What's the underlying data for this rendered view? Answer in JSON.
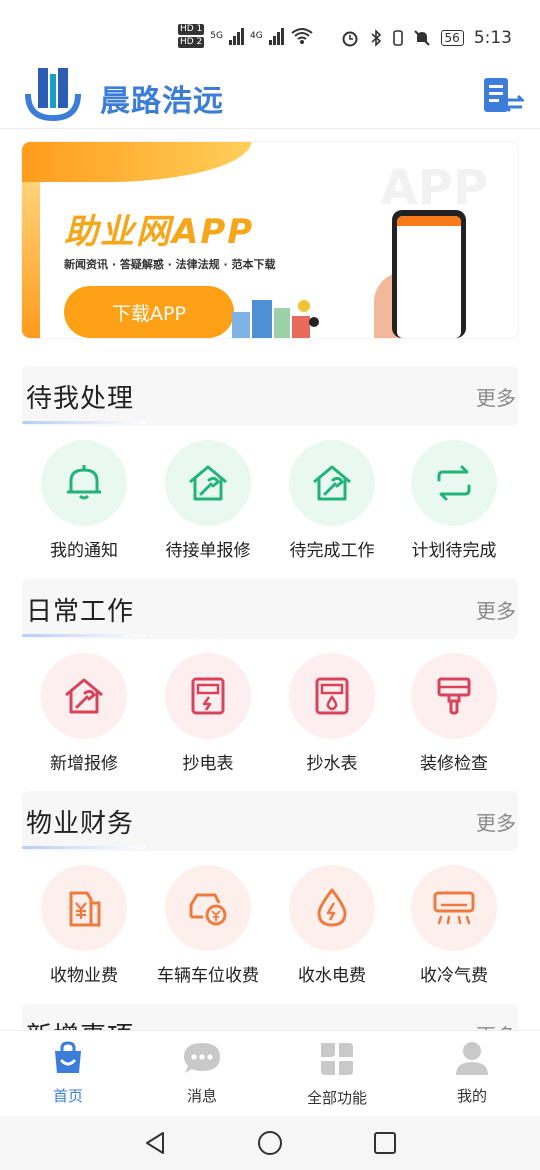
{
  "status": {
    "hd1": "HD 1",
    "hd2": "HD 2",
    "net1": "5G",
    "net2": "4G",
    "battery": "56",
    "time": "5:13"
  },
  "header": {
    "title": "晨路浩远"
  },
  "banner": {
    "title": "助业网APP",
    "subtitle": "新闻资讯 · 答疑解惑 · 法律法规 · 范本下载",
    "button": "下载APP",
    "watermark": "APP"
  },
  "sections": [
    {
      "title": "待我处理",
      "more": "更多",
      "items": [
        {
          "label": "我的通知",
          "icon": "bell-icon"
        },
        {
          "label": "待接单报修",
          "icon": "house-wrench-icon"
        },
        {
          "label": "待完成工作",
          "icon": "house-wrench-icon"
        },
        {
          "label": "计划待完成",
          "icon": "repeat-icon"
        }
      ]
    },
    {
      "title": "日常工作",
      "more": "更多",
      "items": [
        {
          "label": "新增报修",
          "icon": "house-wrench-icon"
        },
        {
          "label": "抄电表",
          "icon": "electric-meter-icon"
        },
        {
          "label": "抄水表",
          "icon": "water-meter-icon"
        },
        {
          "label": "装修检查",
          "icon": "paint-brush-icon"
        }
      ]
    },
    {
      "title": "物业财务",
      "more": "更多",
      "items": [
        {
          "label": "收物业费",
          "icon": "yen-card-icon"
        },
        {
          "label": "车辆车位收费",
          "icon": "car-yen-icon"
        },
        {
          "label": "收水电费",
          "icon": "drop-bolt-icon"
        },
        {
          "label": "收冷气费",
          "icon": "air-conditioner-icon"
        }
      ]
    },
    {
      "title": "新增事项",
      "more": "更多"
    }
  ],
  "colors": {
    "brand": "#3b7dd8",
    "green": "#22b37a",
    "red": "#d8435a",
    "orange": "#f07a3e"
  },
  "tabs": [
    {
      "label": "首页",
      "icon": "home-bag-icon"
    },
    {
      "label": "消息",
      "icon": "chat-bubble-icon"
    },
    {
      "label": "全部功能",
      "icon": "grid-petals-icon"
    },
    {
      "label": "我的",
      "icon": "user-icon"
    }
  ]
}
